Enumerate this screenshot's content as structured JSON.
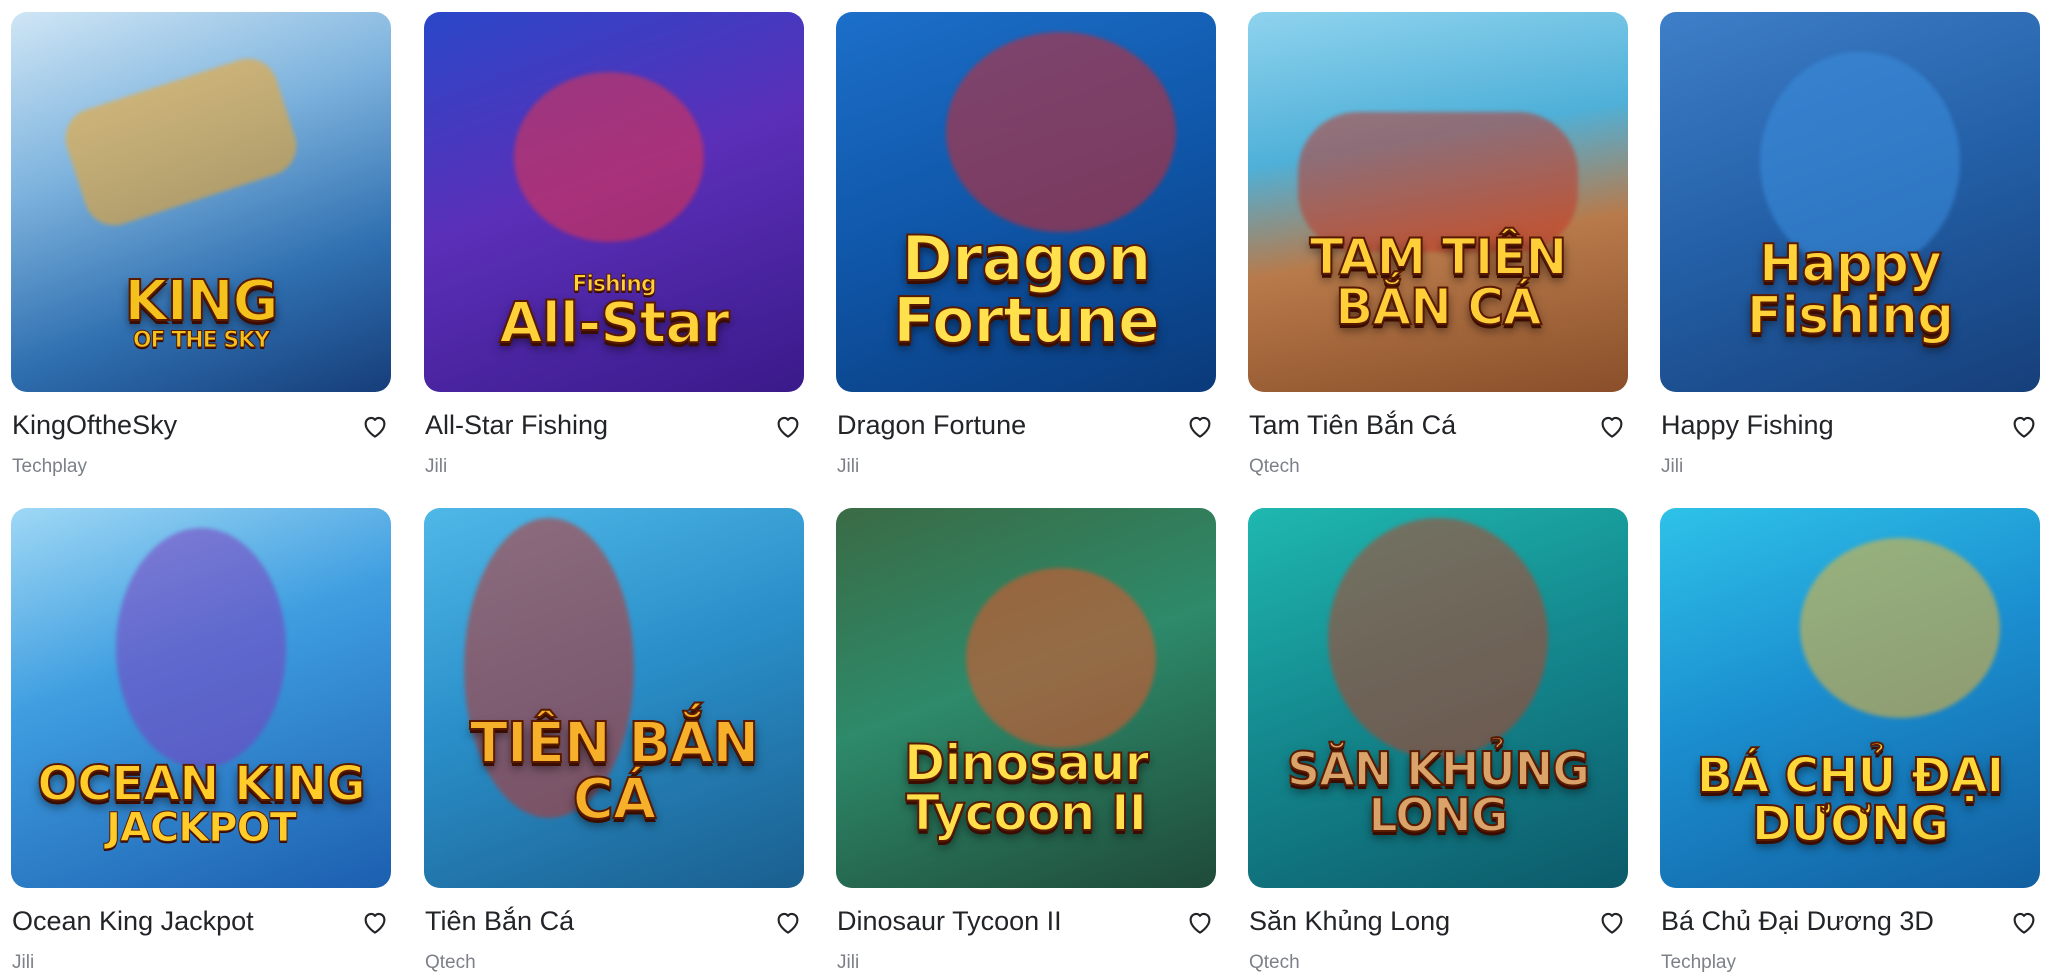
{
  "games": [
    {
      "title": "KingOftheSky",
      "provider": "Techplay",
      "logo_main": "KING",
      "logo_sub": "OF THE SKY",
      "bg": "linear-gradient(160deg,#cfe6f5 0%,#7fb4de 35%,#2f6fb0 70%,#163e7a 100%)",
      "logo_color": "#f5c21d",
      "fx": "#f7a520"
    },
    {
      "title": "All-Star Fishing",
      "provider": "Jili",
      "logo_main": "All-Star",
      "logo_sub": "Fishing",
      "bg": "linear-gradient(160deg,#2a47c9 0%,#5b2fb8 45%,#3a1a8a 100%)",
      "logo_color": "#ffd23a",
      "fx": "#e8344a"
    },
    {
      "title": "Dragon Fortune",
      "provider": "Jili",
      "logo_main": "Dragon Fortune",
      "logo_sub": "",
      "bg": "linear-gradient(160deg,#1c6fc9 0%,#0f56a8 50%,#0a3a7a 100%)",
      "logo_color": "#ffe14d",
      "fx": "#d4282a"
    },
    {
      "title": "Tam Tiên Bắn Cá",
      "provider": "Qtech",
      "logo_main": "TAM TIÊN BẮN CÁ",
      "logo_sub": "",
      "bg": "linear-gradient(170deg,#8fd3ee 0%,#4fb0d8 35%,#b87a4a 60%,#8a4f2a 100%)",
      "logo_color": "#ffcf3a",
      "fx": "#c0392b"
    },
    {
      "title": "Happy Fishing",
      "provider": "Jili",
      "logo_main": "Happy Fishing",
      "logo_sub": "",
      "bg": "linear-gradient(160deg,#3e7fc9 0%,#235fa6 50%,#163f7a 100%)",
      "logo_color": "#ffd23a",
      "fx": "#3b8fe0"
    },
    {
      "title": "Ocean King Jackpot",
      "provider": "Jili",
      "logo_main": "OCEAN KING",
      "logo_sub": "JACKPOT",
      "bg": "linear-gradient(160deg,#9fd8f5 0%,#3f9ee0 40%,#1c5fb0 100%)",
      "logo_color": "#ffcc2a",
      "fx": "#7a3fc0"
    },
    {
      "title": "Tiên Bắn Cá",
      "provider": "Qtech",
      "logo_main": "TIÊN BẮN CÁ",
      "logo_sub": "",
      "bg": "linear-gradient(160deg,#4fb8e8 0%,#2a8fc9 45%,#1a5f8f 100%)",
      "logo_color": "#f7b02a",
      "fx": "#c2332a"
    },
    {
      "title": "Dinosaur Tycoon II",
      "provider": "Jili",
      "logo_main": "Dinosaur Tycoon II",
      "logo_sub": "",
      "bg": "linear-gradient(160deg,#3a6b45 0%,#2d8a6a 45%,#1f4a3a 100%)",
      "logo_color": "#ffe04a",
      "fx": "#e8552a"
    },
    {
      "title": "Săn Khủng Long",
      "provider": "Qtech",
      "logo_main": "SĂN KHỦNG LONG",
      "logo_sub": "",
      "bg": "linear-gradient(160deg,#1fb8b0 0%,#148a8f 45%,#0c5a6a 100%)",
      "logo_color": "#d9a36a",
      "fx": "#b8432a"
    },
    {
      "title": "Bá Chủ Đại Dương 3D",
      "provider": "Techplay",
      "logo_main": "BÁ CHỦ ĐẠI DƯƠNG",
      "logo_sub": "",
      "bg": "linear-gradient(160deg,#2ec2e8 0%,#1b8fd0 45%,#125fa0 100%)",
      "logo_color": "#ffd83a",
      "fx": "#f2b630"
    }
  ],
  "colors": {
    "title_text": "#222428",
    "provider_text": "#7d8088",
    "heart_stroke": "#222428"
  },
  "icons": {
    "favorite": "heart-outline-icon"
  }
}
